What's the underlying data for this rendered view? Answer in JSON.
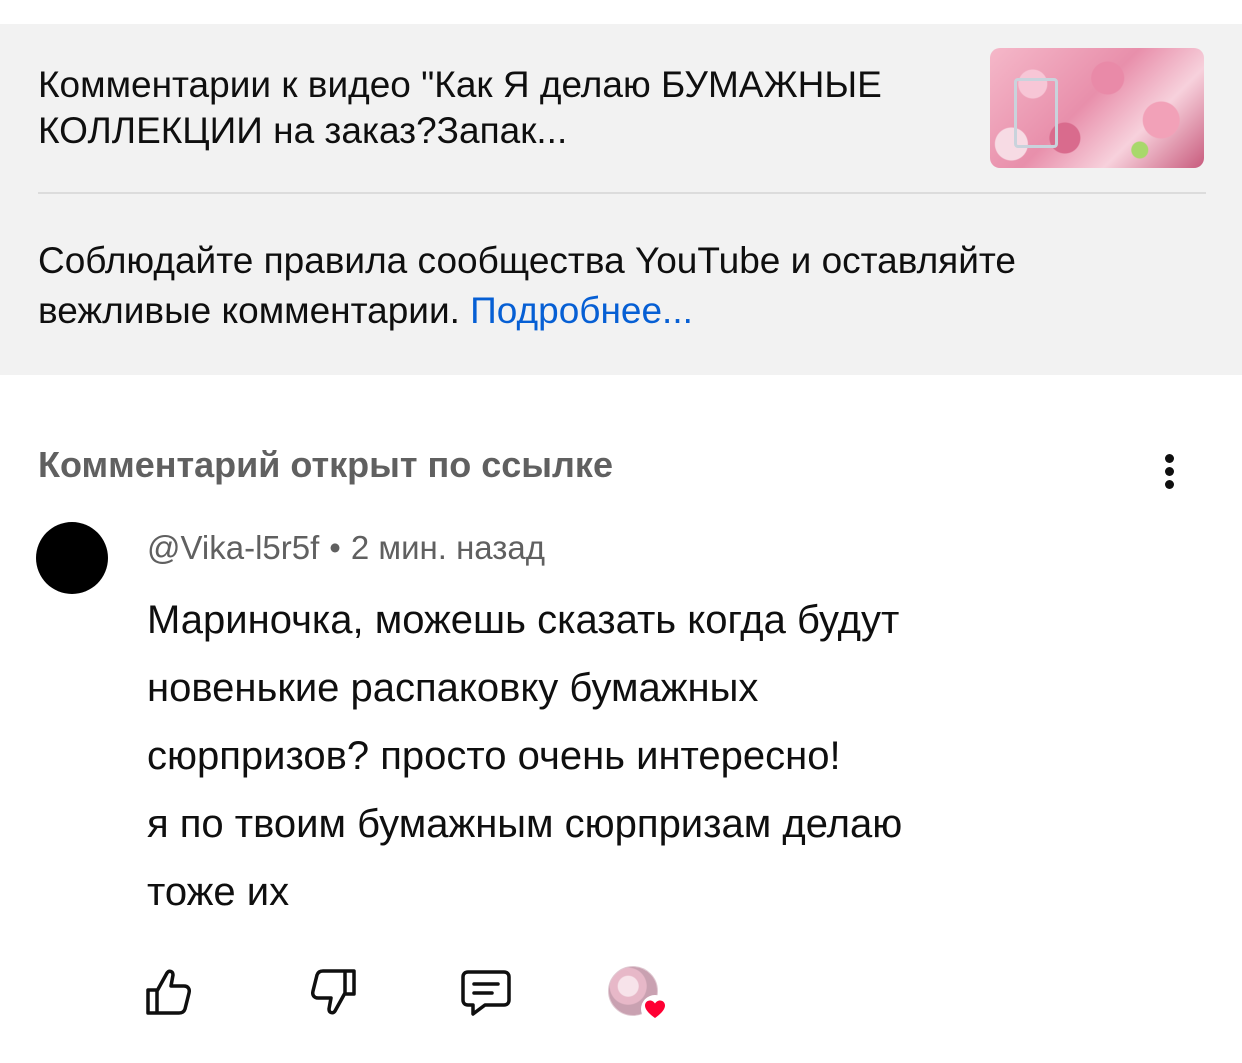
{
  "video": {
    "title": "Комментарии к видео \"Как Я делаю БУМАЖНЫЕ КОЛЛЕКЦИИ на заказ?Запак...",
    "thumbnail_icon": "video-thumbnail"
  },
  "rules": {
    "text": "Соблюдайте правила сообщества YouTube и оставляйте вежливые комментарии.",
    "link_label": "Подробнее..."
  },
  "comment_section": {
    "linked_label": "Комментарий открыт по ссылке",
    "more_icon": "more-vertical-icon"
  },
  "comment": {
    "author": "@Vika-l5r5f",
    "separator": "•",
    "time": "2 мин. назад",
    "lines": [
      "Мариночка, можешь сказать когда будут",
      "новенькие распаковку бумажных",
      "сюрпризов? просто очень интересно!",
      "я по твоим бумажным сюрпризам делаю",
      "тоже их"
    ]
  },
  "actions": {
    "like_icon": "thumbs-up-icon",
    "dislike_icon": "thumbs-down-icon",
    "reply_icon": "reply-icon",
    "creator_heart_icon": "creator-heart-icon",
    "heart_color": "#ff0033",
    "link_color": "#065fd4"
  }
}
